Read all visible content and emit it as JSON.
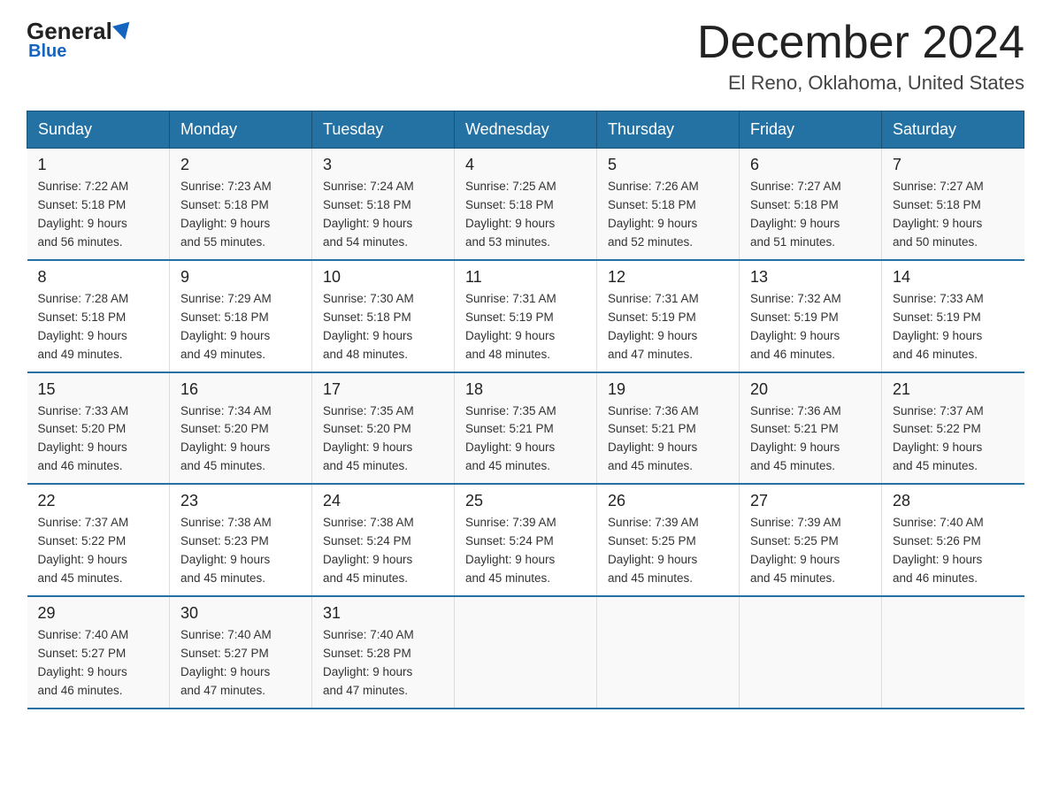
{
  "header": {
    "logo": {
      "general": "General",
      "blue": "Blue"
    },
    "title": "December 2024",
    "subtitle": "El Reno, Oklahoma, United States"
  },
  "days_of_week": [
    "Sunday",
    "Monday",
    "Tuesday",
    "Wednesday",
    "Thursday",
    "Friday",
    "Saturday"
  ],
  "weeks": [
    [
      {
        "date": "1",
        "sunrise": "7:22 AM",
        "sunset": "5:18 PM",
        "daylight": "9 hours and 56 minutes."
      },
      {
        "date": "2",
        "sunrise": "7:23 AM",
        "sunset": "5:18 PM",
        "daylight": "9 hours and 55 minutes."
      },
      {
        "date": "3",
        "sunrise": "7:24 AM",
        "sunset": "5:18 PM",
        "daylight": "9 hours and 54 minutes."
      },
      {
        "date": "4",
        "sunrise": "7:25 AM",
        "sunset": "5:18 PM",
        "daylight": "9 hours and 53 minutes."
      },
      {
        "date": "5",
        "sunrise": "7:26 AM",
        "sunset": "5:18 PM",
        "daylight": "9 hours and 52 minutes."
      },
      {
        "date": "6",
        "sunrise": "7:27 AM",
        "sunset": "5:18 PM",
        "daylight": "9 hours and 51 minutes."
      },
      {
        "date": "7",
        "sunrise": "7:27 AM",
        "sunset": "5:18 PM",
        "daylight": "9 hours and 50 minutes."
      }
    ],
    [
      {
        "date": "8",
        "sunrise": "7:28 AM",
        "sunset": "5:18 PM",
        "daylight": "9 hours and 49 minutes."
      },
      {
        "date": "9",
        "sunrise": "7:29 AM",
        "sunset": "5:18 PM",
        "daylight": "9 hours and 49 minutes."
      },
      {
        "date": "10",
        "sunrise": "7:30 AM",
        "sunset": "5:18 PM",
        "daylight": "9 hours and 48 minutes."
      },
      {
        "date": "11",
        "sunrise": "7:31 AM",
        "sunset": "5:19 PM",
        "daylight": "9 hours and 48 minutes."
      },
      {
        "date": "12",
        "sunrise": "7:31 AM",
        "sunset": "5:19 PM",
        "daylight": "9 hours and 47 minutes."
      },
      {
        "date": "13",
        "sunrise": "7:32 AM",
        "sunset": "5:19 PM",
        "daylight": "9 hours and 46 minutes."
      },
      {
        "date": "14",
        "sunrise": "7:33 AM",
        "sunset": "5:19 PM",
        "daylight": "9 hours and 46 minutes."
      }
    ],
    [
      {
        "date": "15",
        "sunrise": "7:33 AM",
        "sunset": "5:20 PM",
        "daylight": "9 hours and 46 minutes."
      },
      {
        "date": "16",
        "sunrise": "7:34 AM",
        "sunset": "5:20 PM",
        "daylight": "9 hours and 45 minutes."
      },
      {
        "date": "17",
        "sunrise": "7:35 AM",
        "sunset": "5:20 PM",
        "daylight": "9 hours and 45 minutes."
      },
      {
        "date": "18",
        "sunrise": "7:35 AM",
        "sunset": "5:21 PM",
        "daylight": "9 hours and 45 minutes."
      },
      {
        "date": "19",
        "sunrise": "7:36 AM",
        "sunset": "5:21 PM",
        "daylight": "9 hours and 45 minutes."
      },
      {
        "date": "20",
        "sunrise": "7:36 AM",
        "sunset": "5:21 PM",
        "daylight": "9 hours and 45 minutes."
      },
      {
        "date": "21",
        "sunrise": "7:37 AM",
        "sunset": "5:22 PM",
        "daylight": "9 hours and 45 minutes."
      }
    ],
    [
      {
        "date": "22",
        "sunrise": "7:37 AM",
        "sunset": "5:22 PM",
        "daylight": "9 hours and 45 minutes."
      },
      {
        "date": "23",
        "sunrise": "7:38 AM",
        "sunset": "5:23 PM",
        "daylight": "9 hours and 45 minutes."
      },
      {
        "date": "24",
        "sunrise": "7:38 AM",
        "sunset": "5:24 PM",
        "daylight": "9 hours and 45 minutes."
      },
      {
        "date": "25",
        "sunrise": "7:39 AM",
        "sunset": "5:24 PM",
        "daylight": "9 hours and 45 minutes."
      },
      {
        "date": "26",
        "sunrise": "7:39 AM",
        "sunset": "5:25 PM",
        "daylight": "9 hours and 45 minutes."
      },
      {
        "date": "27",
        "sunrise": "7:39 AM",
        "sunset": "5:25 PM",
        "daylight": "9 hours and 45 minutes."
      },
      {
        "date": "28",
        "sunrise": "7:40 AM",
        "sunset": "5:26 PM",
        "daylight": "9 hours and 46 minutes."
      }
    ],
    [
      {
        "date": "29",
        "sunrise": "7:40 AM",
        "sunset": "5:27 PM",
        "daylight": "9 hours and 46 minutes."
      },
      {
        "date": "30",
        "sunrise": "7:40 AM",
        "sunset": "5:27 PM",
        "daylight": "9 hours and 47 minutes."
      },
      {
        "date": "31",
        "sunrise": "7:40 AM",
        "sunset": "5:28 PM",
        "daylight": "9 hours and 47 minutes."
      },
      null,
      null,
      null,
      null
    ]
  ],
  "labels": {
    "sunrise": "Sunrise:",
    "sunset": "Sunset:",
    "daylight": "Daylight:"
  }
}
